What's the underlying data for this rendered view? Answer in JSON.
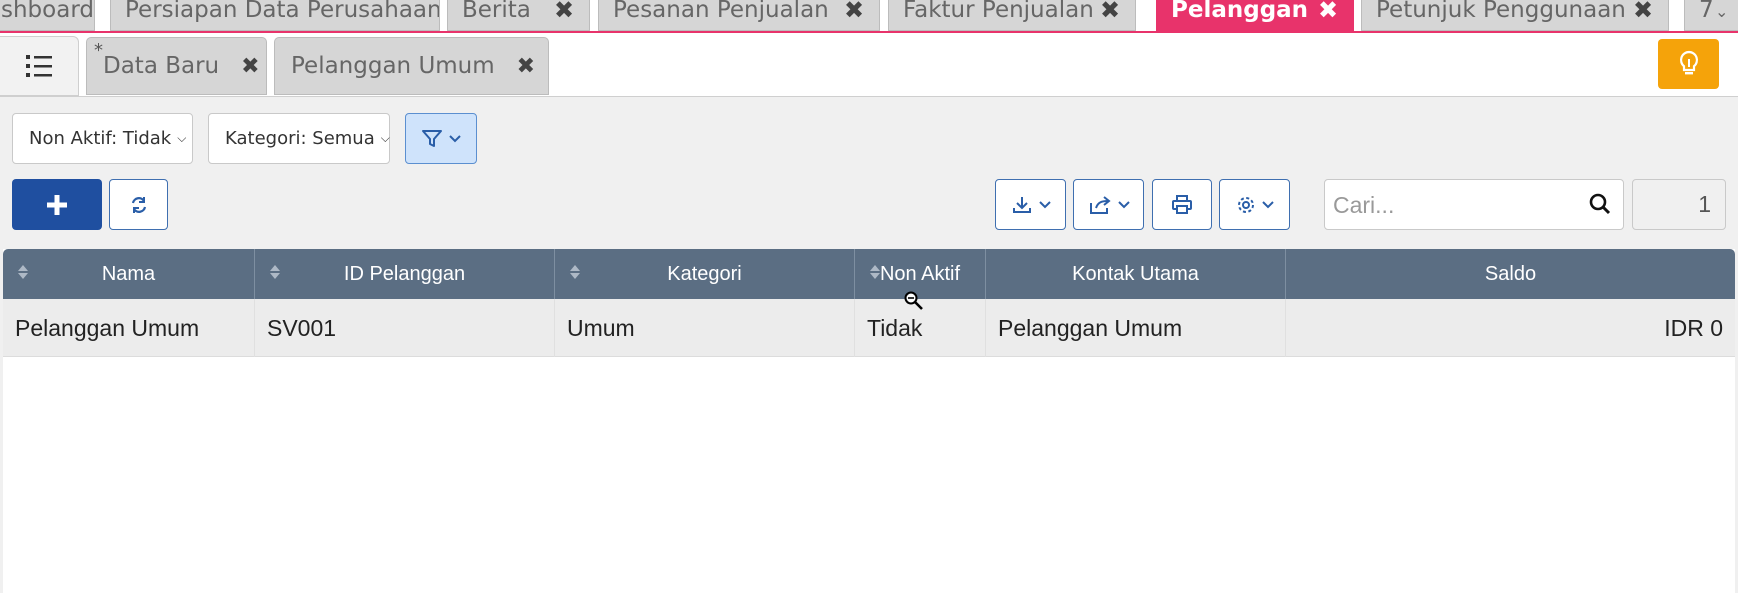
{
  "top_tabs": [
    {
      "label": "shboard",
      "closable": false,
      "active": false
    },
    {
      "label": "Persiapan Data Perusahaan",
      "closable": false,
      "active": false
    },
    {
      "label": "Berita",
      "closable": true,
      "active": false
    },
    {
      "label": "Pesanan Penjualan",
      "closable": true,
      "active": false
    },
    {
      "label": "Faktur Penjualan",
      "closable": true,
      "active": false
    },
    {
      "label": "Pelanggan",
      "closable": true,
      "active": true
    },
    {
      "label": "Petunjuk Penggunaan",
      "closable": true,
      "active": false
    },
    {
      "label": "7",
      "closable": false,
      "active": false
    }
  ],
  "sub_tabs": [
    {
      "label": "Data Baru",
      "modified_marker": "*"
    },
    {
      "label": "Pelanggan Umum",
      "modified_marker": ""
    }
  ],
  "filters": {
    "non_aktif": "Non Aktif: Tidak",
    "kategori": "Kategori: Semua"
  },
  "search": {
    "placeholder": "Cari..."
  },
  "page_number": "1",
  "table": {
    "columns": [
      "Nama",
      "ID Pelanggan",
      "Kategori",
      "Non Aktif",
      "Kontak Utama",
      "Saldo"
    ],
    "rows": [
      [
        "Pelanggan Umum",
        "SV001",
        "Umum",
        "Tidak",
        "Pelanggan Umum",
        "IDR 0"
      ]
    ]
  },
  "colors": {
    "active_tab": "#e8336b",
    "header_bg": "#5b6e83",
    "primary_button": "#1f4fa0",
    "bulb_button": "#f5a30a",
    "filter_active": "#cfe3fb"
  }
}
